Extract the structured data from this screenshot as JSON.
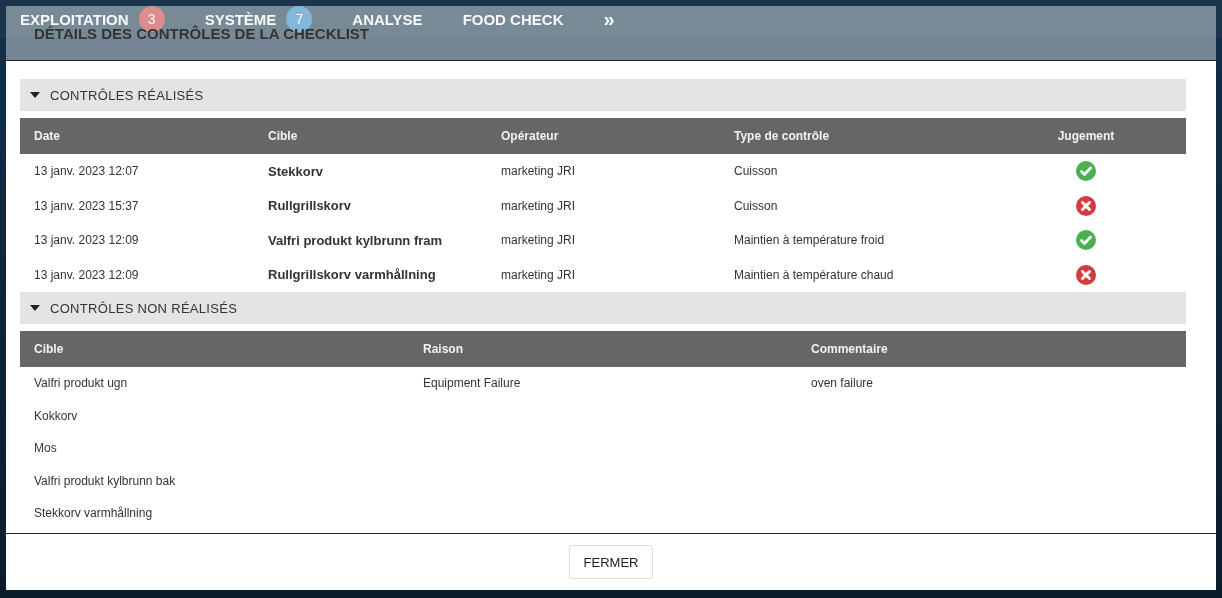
{
  "nav": {
    "items": [
      {
        "label": "EXPLOITATION",
        "badge": "3"
      },
      {
        "label": "SYSTÈME",
        "badge": "7"
      },
      {
        "label": "ANALYSE"
      },
      {
        "label": "FOOD CHECK"
      }
    ],
    "more": "»"
  },
  "dialog": {
    "title": "DÉTAILS DES CONTRÔLES DE LA CHECKLIST",
    "done": {
      "title": "CONTRÔLES RÉALISÉS",
      "expanded": true,
      "columns": [
        "Date",
        "Cible",
        "Opérateur",
        "Type de contrôle",
        "Jugement"
      ],
      "rows": [
        {
          "date": "13 janv. 2023 12:07",
          "target": "Stekkorv",
          "operator": "marketing JRI",
          "type": "Cuisson",
          "passed": true
        },
        {
          "date": "13 janv. 2023 15:37",
          "target": "Rullgrillskorv",
          "operator": "marketing JRI",
          "type": "Cuisson",
          "passed": false
        },
        {
          "date": "13 janv. 2023 12:09",
          "target": "Valfri produkt kylbrunn fram",
          "operator": "marketing JRI",
          "type": "Maintien à température froid",
          "passed": true
        },
        {
          "date": "13 janv. 2023 12:09",
          "target": "Rullgrillskorv varmhållning",
          "operator": "marketing JRI",
          "type": "Maintien à température chaud",
          "passed": false
        }
      ]
    },
    "not_done": {
      "title": "CONTRÔLES NON RÉALISÉS",
      "expanded": true,
      "columns": [
        "Cible",
        "Raison",
        "Commentaire"
      ],
      "rows": [
        {
          "target": "Valfri produkt ugn",
          "reason": "Equipment Failure",
          "comment": "oven failure"
        },
        {
          "target": "Kokkorv"
        },
        {
          "target": "Mos"
        },
        {
          "target": "Valfri produkt kylbrunn bak"
        },
        {
          "target": "Stekkorv varmhållning"
        }
      ]
    },
    "close_button": "FERMER"
  }
}
